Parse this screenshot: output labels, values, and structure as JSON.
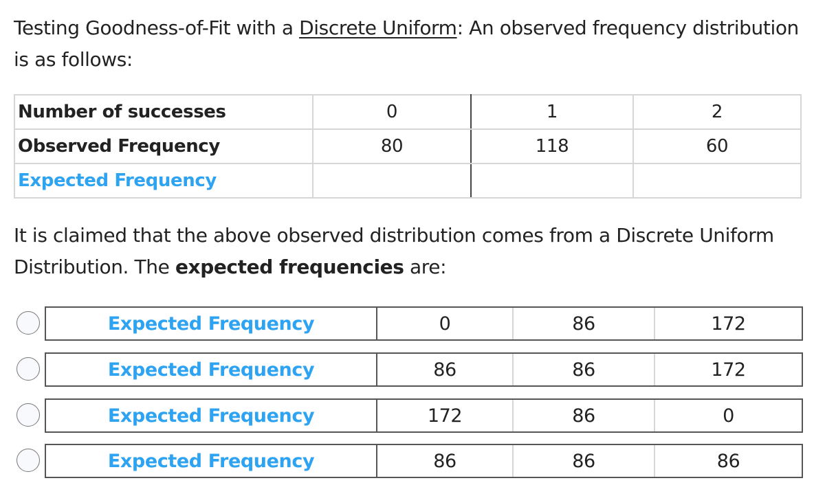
{
  "intro": {
    "prefix": "Testing Goodness-of-Fit with a ",
    "link": "Discrete Uniform",
    "suffix": ": An observed frequency distribution is as follows:"
  },
  "observed_table": {
    "rows": [
      {
        "label": "Number of successes",
        "values": [
          "0",
          "1",
          "2"
        ]
      },
      {
        "label": "Observed Frequency",
        "values": [
          "80",
          "118",
          "60"
        ]
      },
      {
        "label": "Expected Frequency",
        "values": [
          "",
          "",
          ""
        ]
      }
    ]
  },
  "claim": {
    "text": "It is claimed that the above observed distribution comes from a Discrete Uniform Distribution. The ",
    "bold": "expected frequencies",
    "suffix": " are:"
  },
  "options": [
    {
      "label": "Expected Frequency",
      "values": [
        "0",
        "86",
        "172"
      ],
      "selected": false
    },
    {
      "label": "Expected Frequency",
      "values": [
        "86",
        "86",
        "172"
      ],
      "selected": false
    },
    {
      "label": "Expected Frequency",
      "values": [
        "172",
        "86",
        "0"
      ],
      "selected": false
    },
    {
      "label": "Expected Frequency",
      "values": [
        "86",
        "86",
        "86"
      ],
      "selected": false
    }
  ],
  "colors": {
    "accent": "#2ea3f2",
    "text": "#222222"
  }
}
